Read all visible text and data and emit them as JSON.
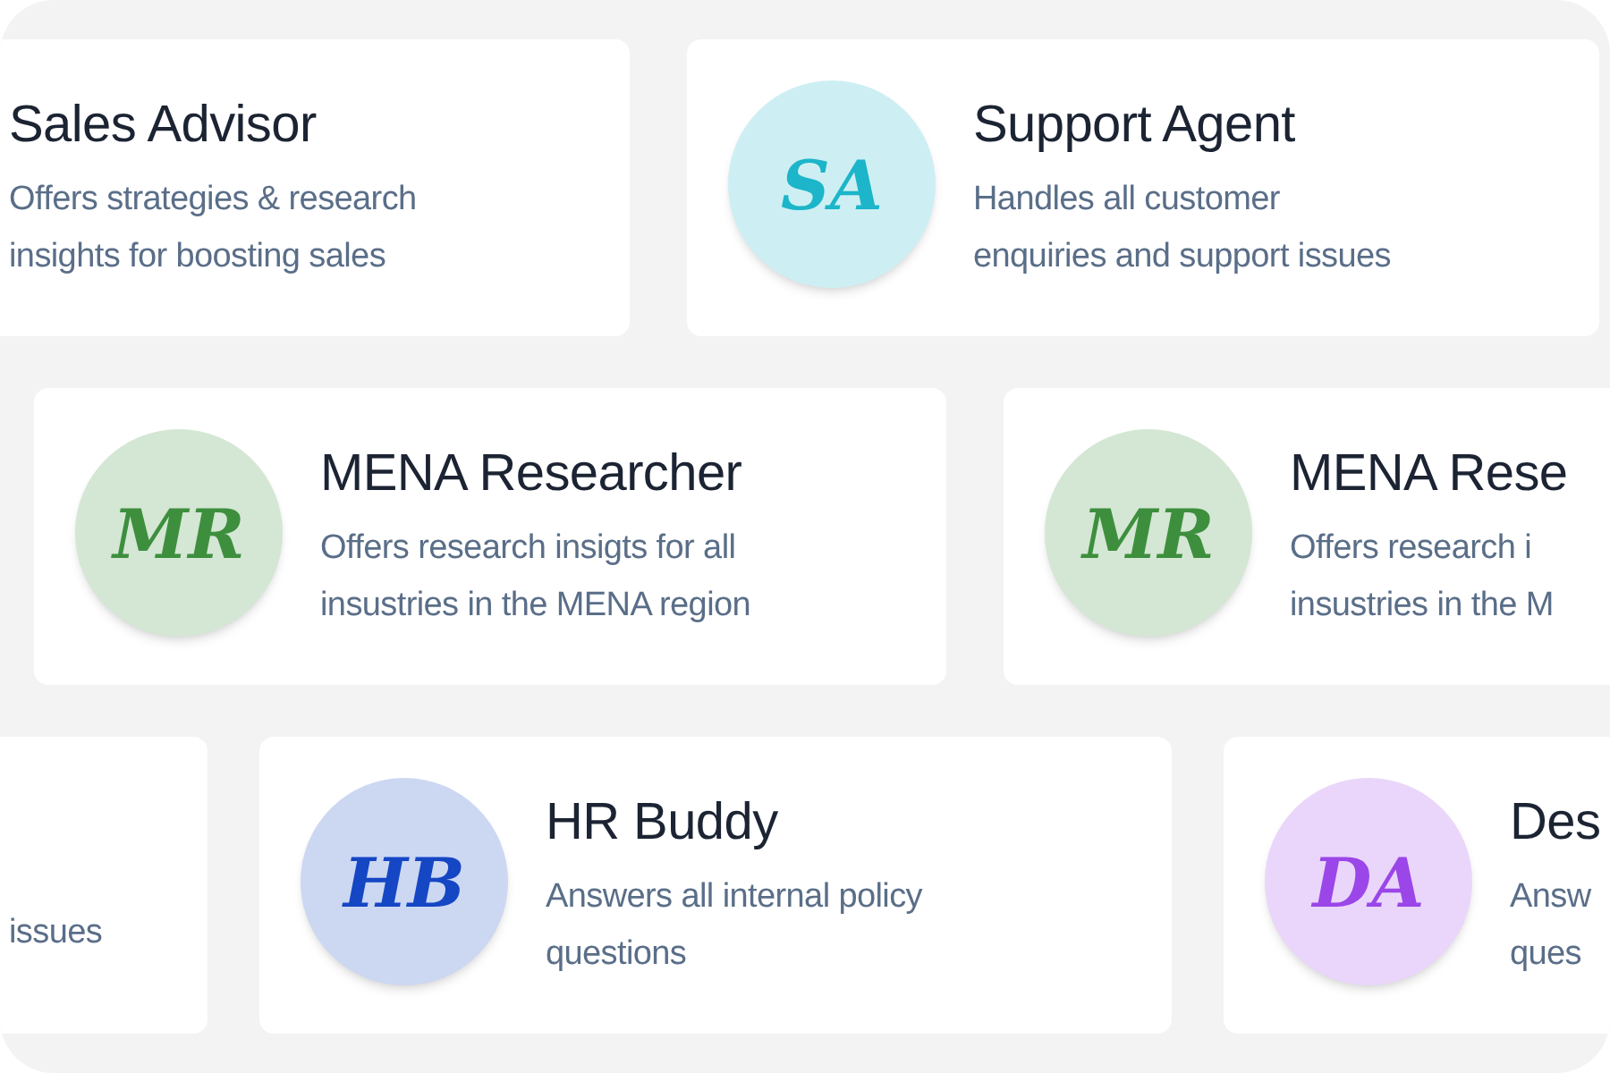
{
  "rows": [
    {
      "cards": [
        {
          "kind": "text_only",
          "title": "Sales Advisor",
          "description_lines": [
            "Offers strategies & research",
            "insights for boosting sales"
          ]
        },
        {
          "kind": "avatar",
          "initials": "SA",
          "color": "#1cb5c9",
          "title": "Support Agent",
          "description_lines": [
            "Handles all customer",
            "enquiries and support issues"
          ]
        }
      ]
    },
    {
      "cards": [
        {
          "kind": "avatar",
          "initials": "MR",
          "color": "#3d8f3d",
          "title": "MENA Researcher",
          "description_lines": [
            "Offers research insigts for all",
            "insustries in the MENA region"
          ]
        },
        {
          "kind": "avatar",
          "initials": "MR",
          "color": "#3d8f3d",
          "title": "MENA Rese",
          "description_lines": [
            "Offers research i",
            "insustries in the M"
          ]
        }
      ]
    },
    {
      "cards": [
        {
          "kind": "text_only",
          "description_lines": [
            "issues"
          ]
        },
        {
          "kind": "avatar",
          "initials": "HB",
          "color": "#1547c4",
          "title": "HR Buddy",
          "description_lines": [
            "Answers all internal policy",
            "questions"
          ]
        },
        {
          "kind": "avatar",
          "initials": "DA",
          "color": "#9b46e8",
          "title": "Des",
          "description_lines": [
            "Answ",
            "ques"
          ]
        }
      ]
    }
  ]
}
